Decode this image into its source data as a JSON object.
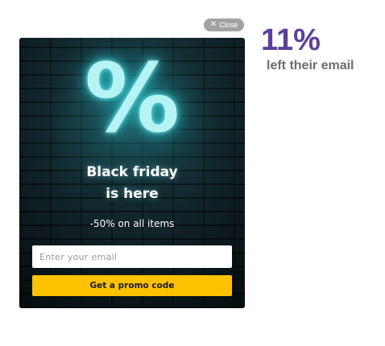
{
  "close": {
    "icon": "close-icon",
    "glyph": "✕",
    "label": "Close"
  },
  "popup": {
    "percent_glyph": "%",
    "headline_line1": "Black friday",
    "headline_line2": "is here",
    "subline": "-50% on all items",
    "email_placeholder": "Enter your email",
    "button_label": "Get a promo code",
    "colors": {
      "button": "#ffc200",
      "glow": "#7ee8ea",
      "background": "#132a30"
    }
  },
  "stat": {
    "value": "11%",
    "label": "left their email",
    "value_color": "#5b3f9e",
    "label_color": "#6d6d6d"
  }
}
